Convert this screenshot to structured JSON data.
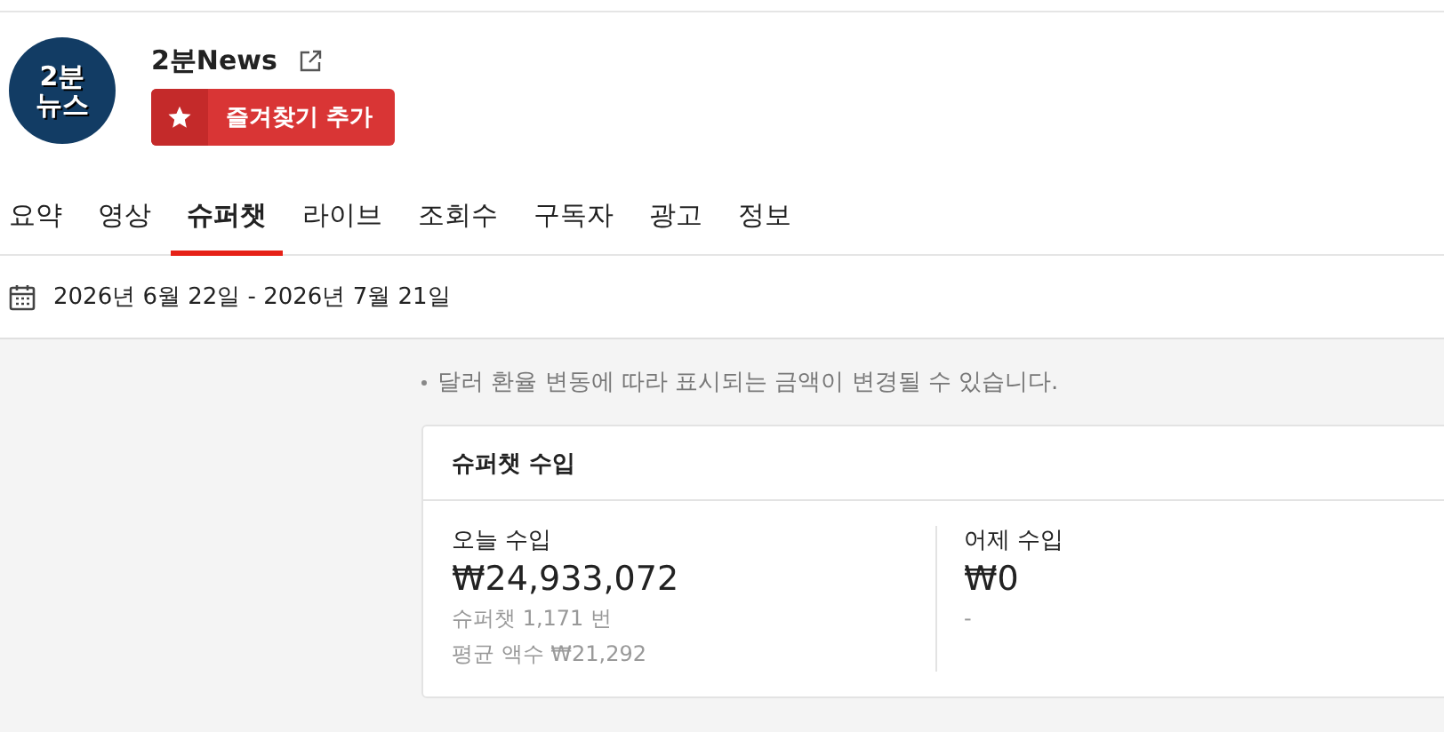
{
  "channel": {
    "logo_lines": [
      "2분",
      "뉴스"
    ],
    "name": "2분News",
    "favorite_button": "즐겨찾기 추가"
  },
  "tabs": [
    {
      "label": "요약",
      "selected": false
    },
    {
      "label": "영상",
      "selected": false
    },
    {
      "label": "슈퍼챗",
      "selected": true
    },
    {
      "label": "라이브",
      "selected": false
    },
    {
      "label": "조회수",
      "selected": false
    },
    {
      "label": "구독자",
      "selected": false
    },
    {
      "label": "광고",
      "selected": false
    },
    {
      "label": "정보",
      "selected": false
    }
  ],
  "date_range": "2026년 6월 22일 - 2026년 7월 21일",
  "notice": "달러 환율 변동에 따라 표시되는 금액이 변경될 수 있습니다.",
  "card": {
    "title": "슈퍼챗 수입",
    "columns": [
      {
        "label": "오늘 수입",
        "amount": "₩24,933,072",
        "details": [
          "슈퍼챗 1,171 번",
          "평균 액수 ₩21,292"
        ]
      },
      {
        "label": "어제 수입",
        "amount": "₩0",
        "details": [
          "-"
        ]
      }
    ]
  }
}
